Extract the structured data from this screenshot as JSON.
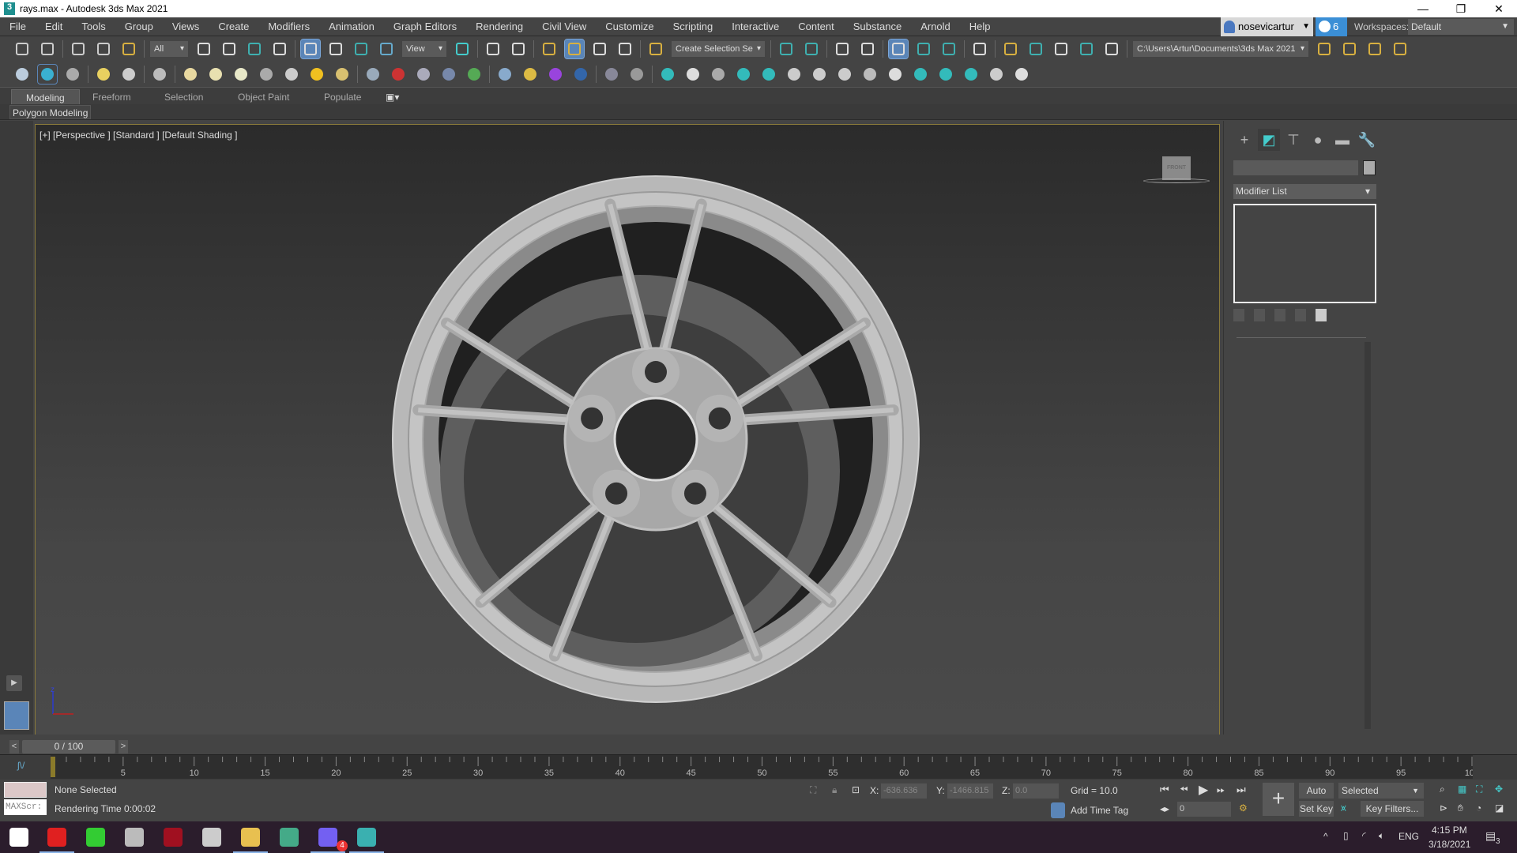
{
  "window": {
    "title": "rays.max - Autodesk 3ds Max 2021",
    "controls": [
      "—",
      "❐",
      "✕"
    ]
  },
  "menu": [
    "File",
    "Edit",
    "Tools",
    "Group",
    "Views",
    "Create",
    "Modifiers",
    "Animation",
    "Graph Editors",
    "Rendering",
    "Civil View",
    "Customize",
    "Scripting",
    "Interactive",
    "Content",
    "Substance",
    "Arnold",
    "Help"
  ],
  "account": {
    "user": "nosevicartur",
    "notifications": "6",
    "workspaces_label": "Workspaces:",
    "workspace": "Default"
  },
  "toolbar1": {
    "selection_filter": "All",
    "ref_coord": "View",
    "named_selection": "Create Selection Se",
    "project_path": "C:\\Users\\Artur\\Documents\\3ds Max 2021",
    "icons": [
      [
        "undo-icon",
        "#ccc"
      ],
      [
        "redo-icon",
        "#ccc"
      ],
      [
        "sep"
      ],
      [
        "link-icon",
        "#ccc"
      ],
      [
        "unlink-icon",
        "#ccc"
      ],
      [
        "bind-spacewarp-icon",
        "#d8b040"
      ],
      [
        "sep"
      ],
      [
        "dd-filter"
      ],
      [
        "select-object-icon",
        "#ddd"
      ],
      [
        "select-by-name-icon",
        "#ddd"
      ],
      [
        "rect-region-icon",
        "#3fb0b0"
      ],
      [
        "window-crossing-icon",
        "#ddd"
      ],
      [
        "sep"
      ],
      [
        "move-icon",
        "#ddd",
        "active"
      ],
      [
        "rotate-icon",
        "#ddd"
      ],
      [
        "scale-icon",
        "#3fb0b0"
      ],
      [
        "placement-icon",
        "#6ac"
      ],
      [
        "dd-view"
      ],
      [
        "pivot-icon",
        "#4cc"
      ],
      [
        "sep"
      ],
      [
        "manipulate-icon",
        "#ddd"
      ],
      [
        "keyboard-shortcut-icon",
        "#ddd"
      ],
      [
        "sep"
      ],
      [
        "snap-toggle-icon",
        "#d8b040"
      ],
      [
        "angle-snap-icon",
        "#d8b040",
        "active"
      ],
      [
        "percent-snap-icon",
        "#ddd"
      ],
      [
        "spinner-snap-icon",
        "#ddd"
      ],
      [
        "sep"
      ],
      [
        "edit-named-sel-icon",
        "#d8b040"
      ],
      [
        "dd-named"
      ],
      [
        "sep"
      ],
      [
        "mirror-icon",
        "#3fb0b0"
      ],
      [
        "align-icon",
        "#3fb0b0"
      ],
      [
        "sep"
      ],
      [
        "scene-explorer-icon",
        "#ddd"
      ],
      [
        "layer-explorer-icon",
        "#ddd"
      ],
      [
        "sep"
      ],
      [
        "toggle-ribbon-icon",
        "#ddd",
        "active"
      ],
      [
        "curve-editor-icon",
        "#3fb0b0"
      ],
      [
        "dope-sheet-icon",
        "#3fb0b0"
      ],
      [
        "sep"
      ],
      [
        "schematic-view-icon",
        "#ddd"
      ],
      [
        "sep"
      ],
      [
        "render-setup-icon",
        "#d8b040"
      ],
      [
        "rendered-frame-icon",
        "#3fb0b0"
      ],
      [
        "render-icon",
        "#ddd"
      ],
      [
        "render-cloud-icon",
        "#3fb0b0"
      ],
      [
        "render-to-texture-icon",
        "#ddd"
      ],
      [
        "sep"
      ],
      [
        "dd-project"
      ],
      [
        "project-folder-icon",
        "#d8b040"
      ],
      [
        "open-project-icon",
        "#d8b040"
      ],
      [
        "new-project-icon",
        "#d8b040"
      ],
      [
        "project-structure-icon",
        "#d8b040"
      ]
    ]
  },
  "toolbar2": {
    "icons": [
      "teapot-icon",
      "box-icon-active",
      "render-window-icon",
      "sep",
      "light-lister-icon",
      "camera-sequencer-icon",
      "sep",
      "camera-icon",
      "sep",
      "plane-icon",
      "dome-icon",
      "sphere-light-icon",
      "teapot-wire-icon",
      "cone-icon",
      "sun-icon",
      "sphere-icon",
      "sep",
      "particles-icon",
      "molecule-icon",
      "lattice-icon",
      "gear-icon",
      "grass-icon",
      "sep",
      "material-sphere-icon",
      "multi-material-icon",
      "material-editor-icon",
      "slate-icon",
      "sep",
      "clipboard-icon",
      "help-icon",
      "sep",
      "photometric-light-icon",
      "sunlight-icon",
      "physical-camera-icon",
      "trees-icon",
      "panel-icon",
      "tree-icon",
      "scatter-icon",
      "cycle-icon",
      "layers-icon",
      "grid-icon",
      "play-window-icon",
      "camera-add-icon",
      "frame-icon",
      "teapot-small-icon",
      "bulb-icon"
    ]
  },
  "ribbon": {
    "tabs": [
      "Modeling",
      "Freeform",
      "Selection",
      "Object Paint",
      "Populate"
    ],
    "active": "Modeling",
    "panel": "Polygon Modeling"
  },
  "viewport": {
    "label": "[+] [Perspective ] [Standard ] [Default Shading ]",
    "viewcube": "FRONT",
    "axis": "z"
  },
  "command_panel": {
    "tabs": [
      [
        "create-icon",
        "+"
      ],
      [
        "modify-icon",
        "◩"
      ],
      [
        "hierarchy-icon",
        "⊤"
      ],
      [
        "motion-icon",
        "●"
      ],
      [
        "display-icon",
        "▬"
      ],
      [
        "utilities-icon",
        "🔧"
      ]
    ],
    "modifier_list": "Modifier List"
  },
  "time": {
    "slider": "0 / 100",
    "start": 0,
    "end": 100,
    "current": 0,
    "major_step": 5
  },
  "status": {
    "selection": "None Selected",
    "maxscript": "MAXScr:",
    "render_time": "Rendering Time  0:00:02",
    "x_label": "X:",
    "x": "-636.636",
    "y_label": "Y:",
    "y": "-1466.815",
    "z_label": "Z:",
    "z": "0.0",
    "grid": "Grid = 10.0",
    "add_time_tag": "Add Time Tag",
    "auto_key": "Auto Key",
    "set_key": "Set Key",
    "key_mode": "Selected",
    "key_filters": "Key Filters...",
    "frame": "0"
  },
  "taskbar": {
    "apps": [
      [
        "start-icon",
        "#fff"
      ],
      [
        "youtube-icon",
        "#e02020"
      ],
      [
        "green-app-icon",
        "#3c3"
      ],
      [
        "clock-app-icon",
        "#bbb"
      ],
      [
        "red-app-icon",
        "#a01020"
      ],
      [
        "snip-icon",
        "#ccc"
      ],
      [
        "file-explorer-icon",
        "#e8c050"
      ],
      [
        "chrome-icon",
        "#4a8"
      ],
      [
        "viber-icon",
        "#7360f2"
      ],
      [
        "3dsmax-icon",
        "#3ab0b0"
      ]
    ],
    "viber_badge": "4",
    "lang": "ENG",
    "time": "4:15 PM",
    "date": "3/18/2021",
    "notif": "3"
  }
}
